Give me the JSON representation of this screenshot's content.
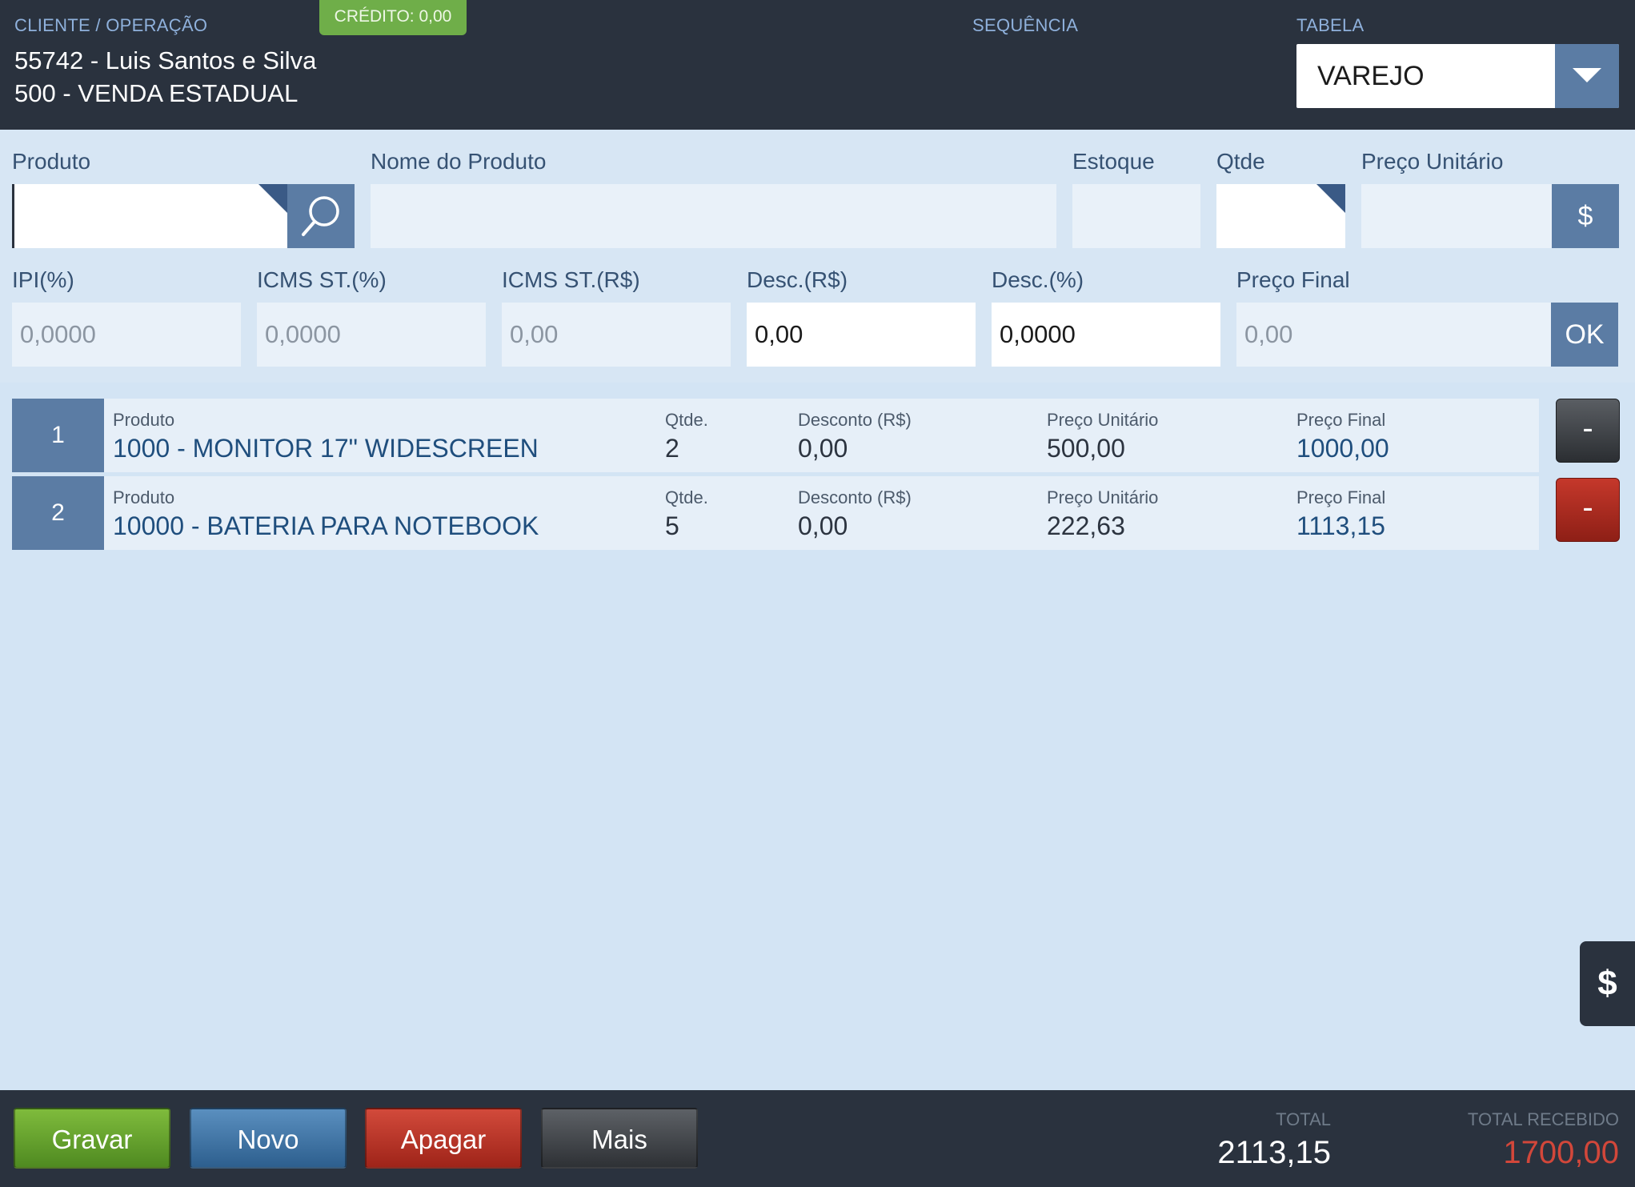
{
  "header": {
    "client_op_label": "CLIENTE / OPERAÇÃO",
    "credit_label": "CRÉDITO:",
    "credit_value": "0,00",
    "client_line": "55742 - Luis Santos e Silva",
    "operation_line": "500 - VENDA ESTADUAL",
    "sequence_label": "SEQUÊNCIA",
    "tabela_label": "TABELA",
    "tabela_value": "VAREJO"
  },
  "form": {
    "produto_label": "Produto",
    "produto_value": "",
    "nome_label": "Nome do Produto",
    "nome_value": "",
    "estoque_label": "Estoque",
    "estoque_value": "",
    "qtde_label": "Qtde",
    "qtde_value": "",
    "preco_unit_label": "Preço Unitário",
    "preco_unit_value": "",
    "dollar_button": "$",
    "ipi_label": "IPI(%)",
    "ipi_value": "0,0000",
    "icms_pct_label": "ICMS ST.(%)",
    "icms_pct_value": "0,0000",
    "icms_rs_label": "ICMS ST.(R$)",
    "icms_rs_value": "0,00",
    "desc_rs_label": "Desc.(R$)",
    "desc_rs_value": "0,00",
    "desc_pct_label": "Desc.(%)",
    "desc_pct_value": "0,0000",
    "preco_final_label": "Preço Final",
    "preco_final_value": "0,00",
    "ok_button": "OK"
  },
  "items": [
    {
      "index": "1",
      "produto_label": "Produto",
      "produto": "1000 - MONITOR 17\" WIDESCREEN",
      "qtde_label": "Qtde.",
      "qtde": "2",
      "desconto_label": "Desconto (R$)",
      "desconto": "0,00",
      "preco_unit_label": "Preço Unitário",
      "preco_unit": "500,00",
      "preco_final_label": "Preço Final",
      "preco_final": "1000,00",
      "remove_label": "-"
    },
    {
      "index": "2",
      "produto_label": "Produto",
      "produto": "10000 - BATERIA PARA NOTEBOOK",
      "qtde_label": "Qtde.",
      "qtde": "5",
      "desconto_label": "Desconto (R$)",
      "desconto": "0,00",
      "preco_unit_label": "Preço Unitário",
      "preco_unit": "222,63",
      "preco_final_label": "Preço Final",
      "preco_final": "1113,15",
      "remove_label": "-"
    }
  ],
  "side_tab_label": "$",
  "footer": {
    "buttons": [
      "Gravar",
      "Novo",
      "Apagar",
      "Mais"
    ],
    "total_label": "TOTAL",
    "total_value": "2113,15",
    "total_recebido_label": "TOTAL RECEBIDO",
    "total_recebido_value": "1700,00"
  },
  "colors": {
    "header_bg": "#2a323e",
    "accent_blue": "#5b7ca4",
    "credit_green": "#6fae49",
    "total_recebido": "#d2473a"
  }
}
